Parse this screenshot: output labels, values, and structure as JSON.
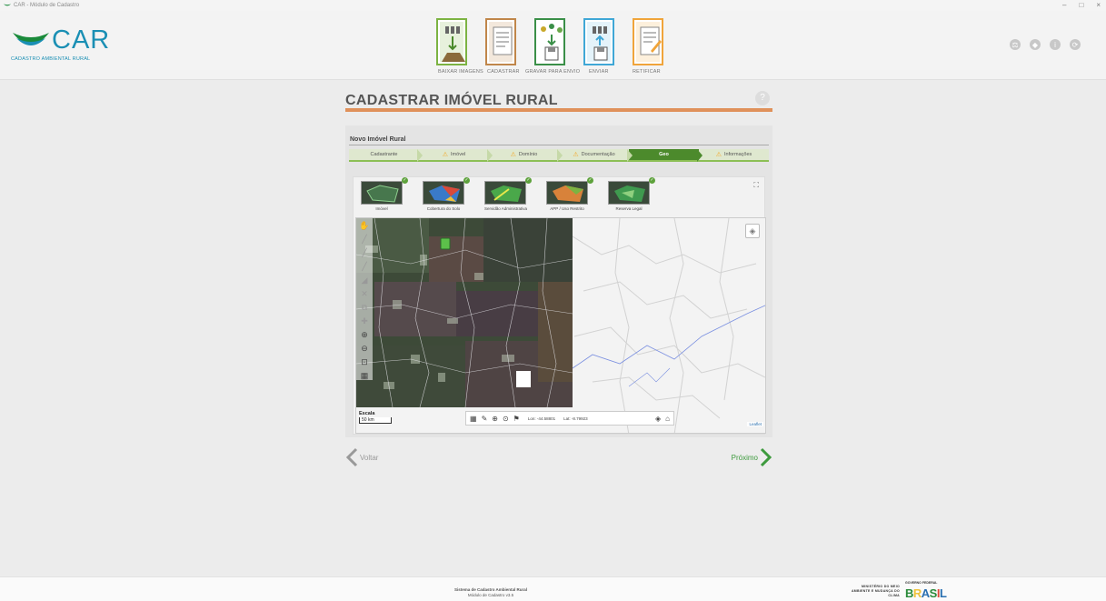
{
  "window": {
    "title": "CAR - Módulo de Cadastro",
    "buttons": [
      "–",
      "□",
      "×"
    ]
  },
  "logo": {
    "name": "CAR",
    "subtitle": "CADASTRO AMBIENTAL RURAL"
  },
  "steps": [
    {
      "label": "BAIXAR IMAGENS",
      "color": "#7cb342"
    },
    {
      "label": "CADASTRAR",
      "color": "#c0864a"
    },
    {
      "label": "GRAVAR PARA ENVIO",
      "color": "#3a8f48"
    },
    {
      "label": "ENVIAR",
      "color": "#3fa7d6"
    },
    {
      "label": "RETIFICAR",
      "color": "#f0a43a"
    }
  ],
  "header_icons": [
    "balance-icon",
    "diamond-icon",
    "info-icon",
    "refresh-icon"
  ],
  "page": {
    "title": "CADASTRAR IMÓVEL RURAL",
    "help": "?",
    "form_title": "Novo Imóvel Rural"
  },
  "tabs": [
    {
      "label": "Cadastrante",
      "warning": false,
      "active": false
    },
    {
      "label": "Imóvel",
      "warning": true,
      "active": false
    },
    {
      "label": "Domínio",
      "warning": true,
      "active": false
    },
    {
      "label": "Documentação",
      "warning": true,
      "active": false
    },
    {
      "label": "Geo",
      "warning": false,
      "active": true
    },
    {
      "label": "Informações",
      "warning": true,
      "active": false
    }
  ],
  "layers": [
    {
      "label": "Imóvel",
      "color": "#3a6e4a"
    },
    {
      "label": "Cobertura do Solo",
      "color": "#c94a3a"
    },
    {
      "label": "Servidão Administrativa",
      "color": "#4aa84a"
    },
    {
      "label": "APP / Uso Restrito",
      "color": "#d8823a"
    },
    {
      "label": "Reserva Legal",
      "color": "#3f9a4f"
    }
  ],
  "map": {
    "scale_label": "Escala",
    "scale_value": "50 km",
    "lon": "Lon: -44.58801",
    "lat": "Lat: -8.79923",
    "attribution": "Leaflet"
  },
  "nav": {
    "back": "Voltar",
    "next": "Próximo"
  },
  "footer": {
    "line1": "Sistema de Cadastro Ambiental Rural",
    "line2": "Módulo de Cadastro v3.5",
    "ministry": "MINISTÉRIO DO MEIO AMBIENTE E MUDANÇA DO CLIMA",
    "gov": "GOVERNO FEDERAL",
    "brasil": "BRASIL"
  }
}
